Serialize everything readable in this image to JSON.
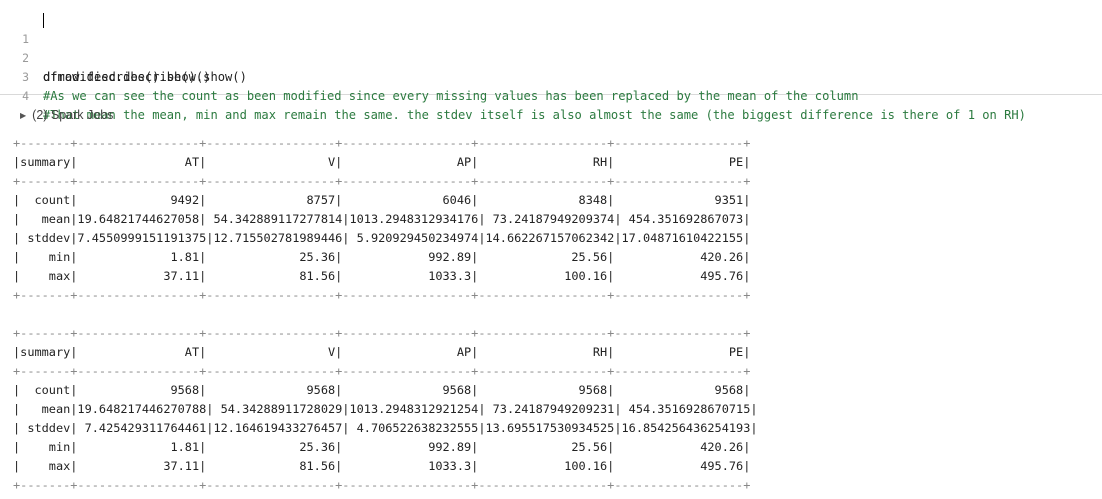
{
  "code_cell": {
    "lines": [
      {
        "num": "1",
        "text": "dfraw.describe().show()",
        "comment": false
      },
      {
        "num": "2",
        "text": "dfmodified.describe().show()",
        "comment": false
      },
      {
        "num": "3",
        "text": "#As we can see the count as been modified since every missing values has been replaced by the mean of the column",
        "comment": true
      },
      {
        "num": "4",
        "text": "#That mean the mean, min and max remain the same. the stdev itself is also almost the same (the biggest difference is there of 1 on RH)",
        "comment": true
      }
    ]
  },
  "spark_jobs": {
    "label": "(2) Spark Jobs",
    "toggle_glyph": "▶"
  },
  "output": {
    "table1": [
      "+-------+-----------------+------------------+------------------+------------------+------------------+",
      "|summary|               AT|                 V|                AP|                RH|                PE|",
      "+-------+-----------------+------------------+------------------+------------------+------------------+",
      "|  count|             9492|              8757|              6046|              8348|              9351|",
      "|   mean|19.64821744627058| 54.342889117277814|1013.2948312934176| 73.24187949209374| 454.351692867073|",
      "| stddev|7.4550999151191375|12.715502781989446| 5.920929450234974|14.662267157062342|17.04871610422155|",
      "|    min|             1.81|             25.36|            992.89|             25.56|            420.26|",
      "|    max|            37.11|             81.56|            1033.3|            100.16|            495.76|",
      "+-------+-----------------+------------------+------------------+------------------+------------------+"
    ],
    "table2": [
      "+-------+-----------------+------------------+------------------+------------------+------------------+",
      "|summary|               AT|                 V|                AP|                RH|                PE|",
      "+-------+-----------------+------------------+------------------+------------------+------------------+",
      "|  count|             9568|              9568|              9568|              9568|              9568|",
      "|   mean|19.648217446270788| 54.34288911728029|1013.2948312921254| 73.24187949209231| 454.3516928670715|",
      "| stddev| 7.425429311764461|12.164619433276457| 4.706522638232555|13.695517530934525|16.854256436254193|",
      "|    min|             1.81|             25.36|            992.89|             25.56|            420.26|",
      "|    max|            37.11|             81.56|            1033.3|            100.16|            495.76|",
      "+-------+-----------------+------------------+------------------+------------------+------------------+"
    ]
  }
}
